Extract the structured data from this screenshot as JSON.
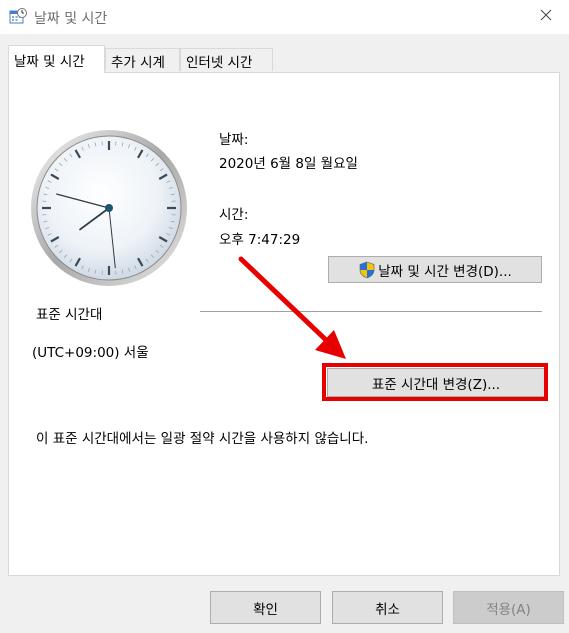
{
  "window": {
    "title": "날짜 및 시간"
  },
  "tabs": [
    {
      "label": "날짜 및 시간"
    },
    {
      "label": "추가 시계"
    },
    {
      "label": "인터넷 시간"
    }
  ],
  "date": {
    "label": "날짜:",
    "value": "2020년 6월 8일 월요일"
  },
  "time": {
    "label": "시간:",
    "value": "오후 7:47:29"
  },
  "buttons": {
    "change_datetime": "날짜 및 시간 변경(D)...",
    "change_timezone": "표준 시간대 변경(Z)...",
    "ok": "확인",
    "cancel": "취소",
    "apply": "적용(A)"
  },
  "timezone": {
    "heading": "표준 시간대",
    "value": "(UTC+09:00) 서울",
    "dst_note": "이 표준 시간대에서는 일광 절약 시간을 사용하지 않습니다."
  },
  "icons": {
    "title": "clock-calendar-icon",
    "close": "close-icon",
    "shield": "uac-shield-icon"
  },
  "colors": {
    "highlight": "#e80000",
    "accent": "#0078d7"
  }
}
